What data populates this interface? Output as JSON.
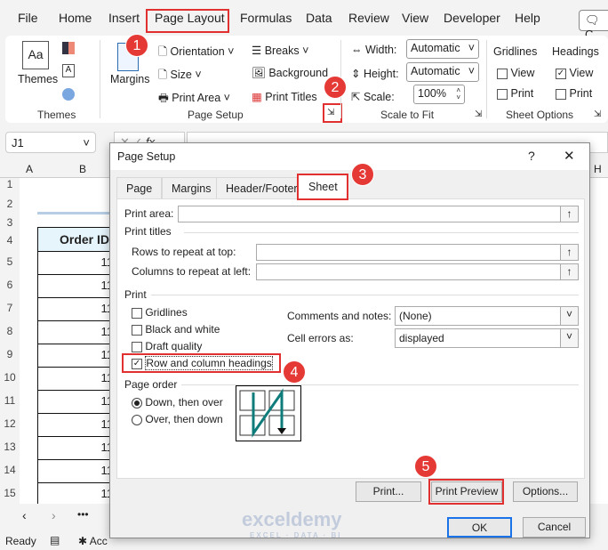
{
  "menu": {
    "items": [
      "File",
      "Home",
      "Insert",
      "Page Layout",
      "Formulas",
      "Data",
      "Review",
      "View",
      "Developer",
      "Help"
    ],
    "active": "Page Layout",
    "comments_btn": "C"
  },
  "ribbon": {
    "themes": {
      "label": "Themes",
      "group": "Themes",
      "icon_text": "Aa"
    },
    "page_setup": {
      "margins": "Margins",
      "orientation": "Orientation",
      "size": "Size",
      "print_area": "Print Area",
      "breaks": "Breaks",
      "background": "Background",
      "print_titles": "Print Titles",
      "group": "Page Setup"
    },
    "scale": {
      "width_label": "Width:",
      "width_value": "Automatic",
      "height_label": "Height:",
      "height_value": "Automatic",
      "scale_label": "Scale:",
      "scale_value": "100%",
      "group": "Scale to Fit"
    },
    "sheet_options": {
      "gridlines": "Gridlines",
      "headings": "Headings",
      "view": "View",
      "print": "Print",
      "gridlines_view": false,
      "gridlines_print": false,
      "headings_view": true,
      "headings_print": false,
      "group": "Sheet Options"
    }
  },
  "formula_bar": {
    "name_box": "J1",
    "fx": "fx"
  },
  "sheet": {
    "columns": [
      "A",
      "B",
      "H"
    ],
    "rows": [
      "1",
      "2",
      "3",
      "4",
      "5",
      "6",
      "7",
      "8",
      "9",
      "10",
      "11",
      "12",
      "13",
      "14",
      "15"
    ],
    "header": "Order ID",
    "cells": [
      "11",
      "11",
      "11",
      "11",
      "11",
      "11",
      "11",
      "11",
      "11",
      "11",
      "11"
    ]
  },
  "status": {
    "ready": "Ready",
    "accessibility": "Acc"
  },
  "dialog": {
    "title": "Page Setup",
    "help": "?",
    "close": "✕",
    "tabs": [
      "Page",
      "Margins",
      "Header/Footer",
      "Sheet"
    ],
    "active_tab": "Sheet",
    "print_area_label": "Print area:",
    "print_area_value": "",
    "print_titles": "Print titles",
    "rows_repeat_label": "Rows to repeat at top:",
    "rows_repeat_value": "",
    "cols_repeat_label": "Columns to repeat at left:",
    "cols_repeat_value": "",
    "print_section": "Print",
    "checkboxes": [
      {
        "label": "Gridlines",
        "checked": false
      },
      {
        "label": "Black and white",
        "checked": false
      },
      {
        "label": "Draft quality",
        "checked": false
      },
      {
        "label": "Row and column headings",
        "checked": true
      }
    ],
    "comments_label": "Comments and notes:",
    "comments_value": "(None)",
    "errors_label": "Cell errors as:",
    "errors_value": "displayed",
    "page_order": "Page order",
    "radios": [
      {
        "label": "Down, then over",
        "selected": true
      },
      {
        "label": "Over, then down",
        "selected": false
      }
    ],
    "buttons": {
      "print": "Print...",
      "preview": "Print Preview",
      "options": "Options...",
      "ok": "OK",
      "cancel": "Cancel"
    }
  },
  "watermark": {
    "name": "exceldemy",
    "tagline": "EXCEL · DATA · BI"
  },
  "steps": [
    "1",
    "2",
    "3",
    "4",
    "5"
  ],
  "colors": {
    "highlight": "#e03030",
    "badge": "#e53935",
    "accent_blue": "#1a73e8",
    "teal_arrow": "#0e7c7b"
  }
}
